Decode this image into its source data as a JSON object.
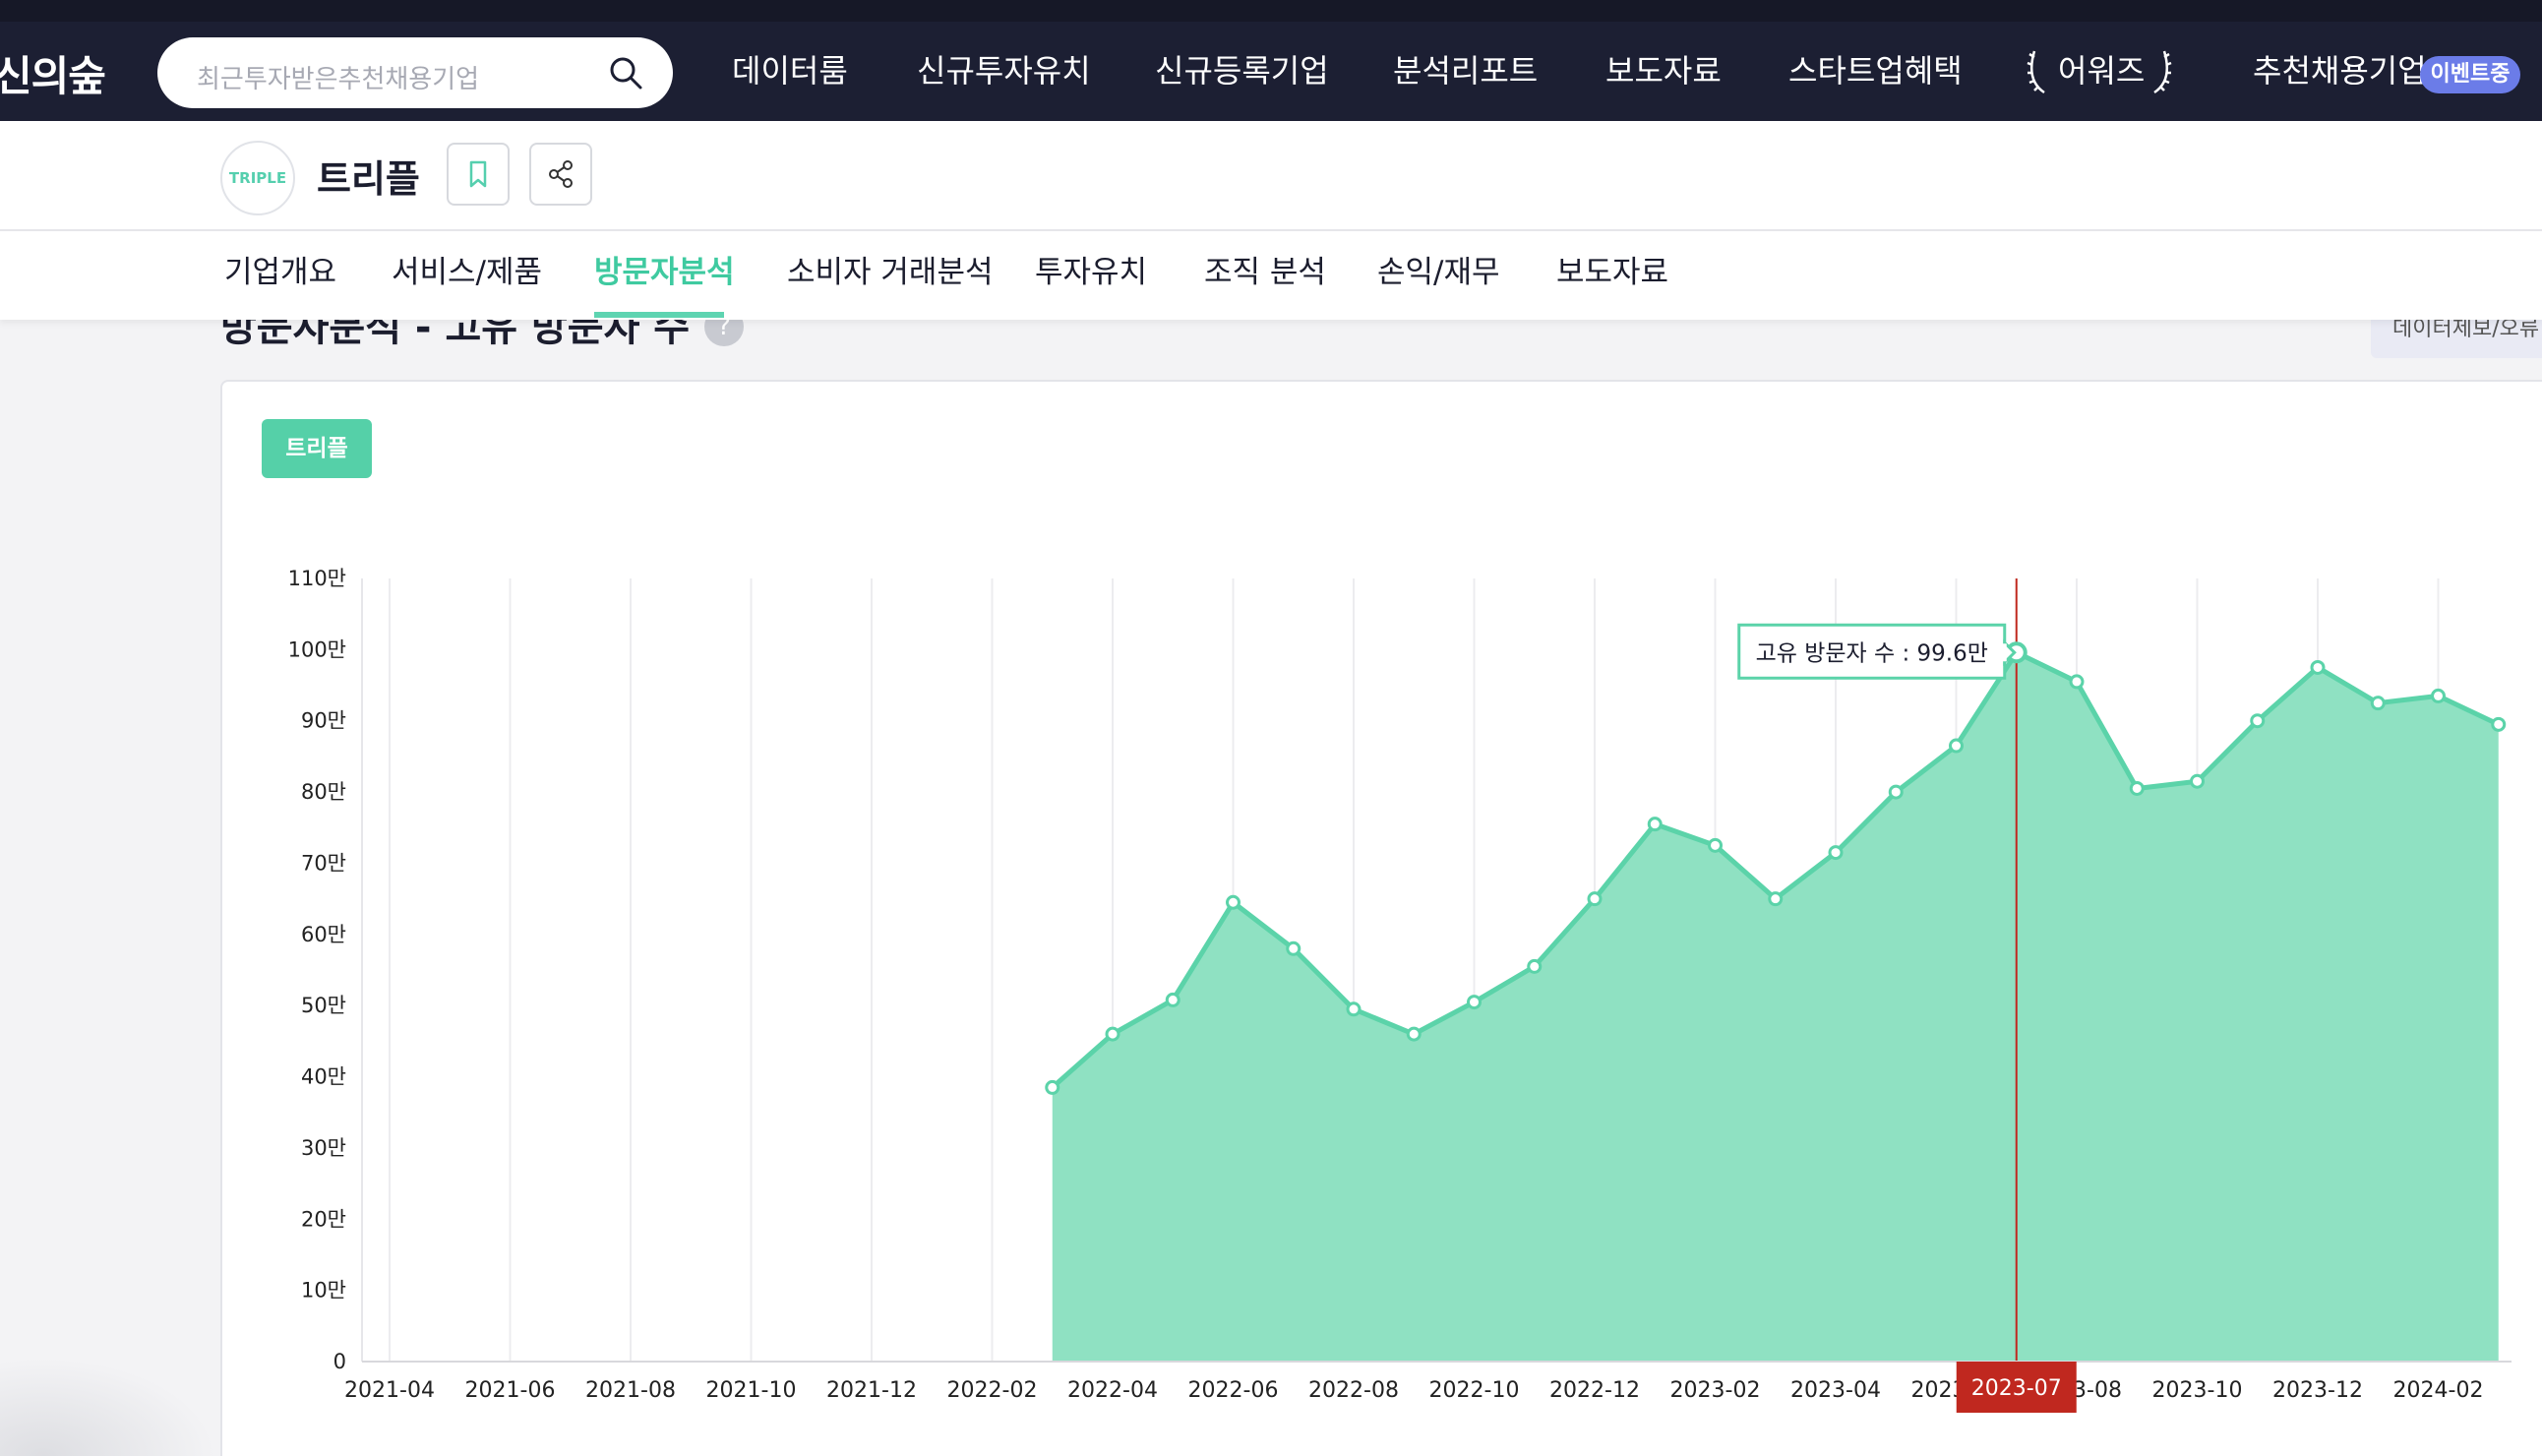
{
  "topnav": {
    "logo_text": "신의숲",
    "search_placeholder": "최근투자받은추천채용기업",
    "items": [
      "데이터룸",
      "신규투자유치",
      "신규등록기업",
      "분석리포트",
      "보도자료",
      "스타트업혜택",
      "어워즈",
      "추천채용기업"
    ],
    "event_badge": "이벤트중"
  },
  "company": {
    "logo_text": "TRIPLE",
    "name": "트리플"
  },
  "tabs": [
    "기업개요",
    "서비스/제품",
    "방문자분석",
    "소비자 거래분석",
    "투자유치",
    "조직 분석",
    "손익/재무",
    "보도자료"
  ],
  "active_tab": "방문자분석",
  "section": {
    "title": "방문자분석 - 고유 방문자 수",
    "help": "?",
    "report_button": "데이터제보/오류"
  },
  "legend": {
    "label": "트리플",
    "color": "#55d0a8"
  },
  "tooltip": {
    "text": "고유 방문자 수 : 99.6만",
    "hover_x_label": "2023-07"
  },
  "chart_data": {
    "type": "area",
    "series": [
      {
        "name": "트리플",
        "x": [
          "2022-03",
          "2022-04",
          "2022-05",
          "2022-06",
          "2022-07",
          "2022-08",
          "2022-09",
          "2022-10",
          "2022-11",
          "2022-12",
          "2023-01",
          "2023-02",
          "2023-03",
          "2023-04",
          "2023-05",
          "2023-06",
          "2023-07",
          "2023-08",
          "2023-09",
          "2023-10",
          "2023-11",
          "2023-12",
          "2024-01",
          "2024-02",
          "2024-03"
        ],
        "values": [
          38.5,
          46.0,
          50.8,
          64.5,
          58.0,
          49.5,
          46.0,
          50.5,
          55.5,
          65.0,
          75.5,
          72.5,
          65.0,
          71.5,
          80.0,
          86.5,
          99.6,
          95.5,
          80.5,
          81.5,
          90.0,
          97.5,
          92.5,
          93.5,
          89.5
        ]
      }
    ],
    "x_categories": [
      "2021-04",
      "2021-05",
      "2021-06",
      "2021-07",
      "2021-08",
      "2021-09",
      "2021-10",
      "2021-11",
      "2021-12",
      "2022-01",
      "2022-02",
      "2022-03",
      "2022-04",
      "2022-05",
      "2022-06",
      "2022-07",
      "2022-08",
      "2022-09",
      "2022-10",
      "2022-11",
      "2022-12",
      "2023-01",
      "2023-02",
      "2023-03",
      "2023-04",
      "2023-05",
      "2023-06",
      "2023-07",
      "2023-08",
      "2023-09",
      "2023-10",
      "2023-11",
      "2023-12",
      "2024-01",
      "2024-02",
      "2024-03"
    ],
    "x_tick_labels": [
      "2021-04",
      "2021-06",
      "2021-08",
      "2021-10",
      "2021-12",
      "2022-02",
      "2022-04",
      "2022-06",
      "2022-08",
      "2022-10",
      "2022-12",
      "2023-02",
      "2023-04",
      "2023-06",
      "2023-08",
      "2023-10",
      "2023-12",
      "2024-02"
    ],
    "y_tick_labels": [
      "0",
      "10만",
      "20만",
      "30만",
      "40만",
      "50만",
      "60만",
      "70만",
      "80만",
      "90만",
      "100만",
      "110만"
    ],
    "ylim": [
      0,
      110
    ],
    "unit": "만",
    "grid": "vertical",
    "colors": {
      "fill": "#8fe1c2",
      "line": "#5bd3a9",
      "hover_line": "#c0281f",
      "hover_label_bg": "#c0281f"
    }
  }
}
